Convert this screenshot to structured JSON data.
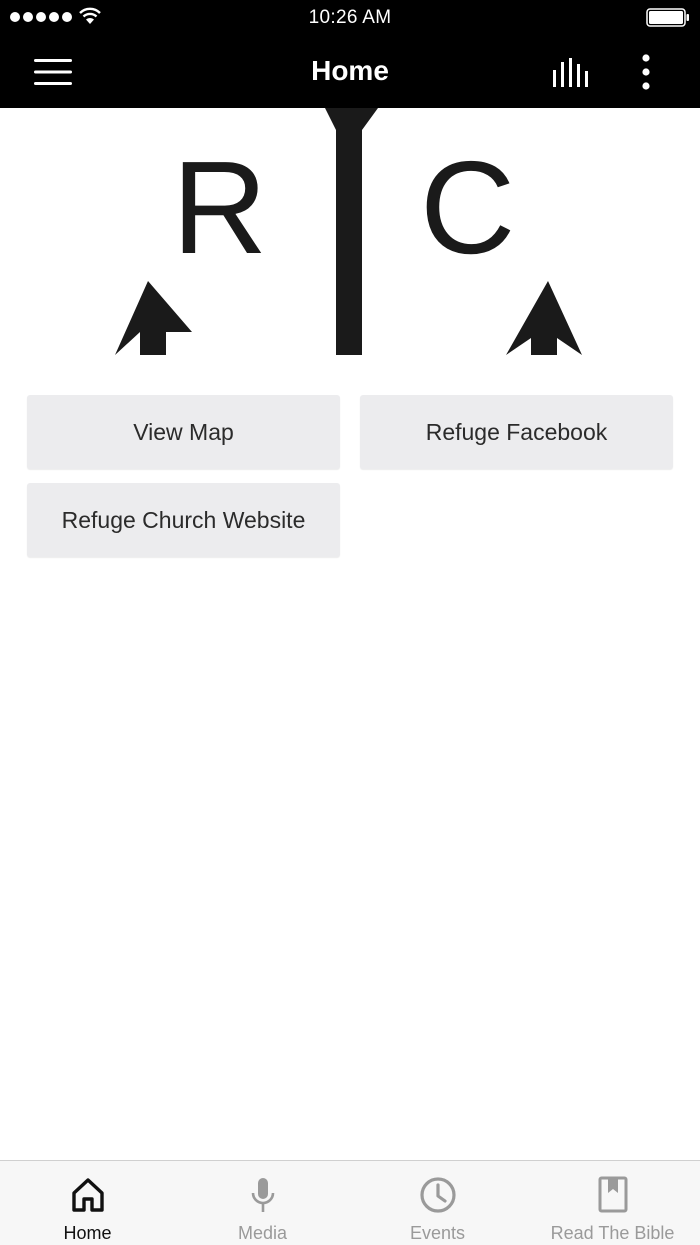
{
  "status_bar": {
    "time": "10:26 AM"
  },
  "nav": {
    "title": "Home",
    "icons": [
      "menu-icon",
      "equalizer-icon",
      "more-vertical-icon"
    ]
  },
  "banner": {
    "logo_letters": [
      "R",
      "C"
    ]
  },
  "buttons": {
    "view_map": "View Map",
    "refuge_facebook": "Refuge Facebook",
    "church_website": "Refuge Church Website"
  },
  "tabs": [
    {
      "label": "Home",
      "icon": "home-icon",
      "active": true
    },
    {
      "label": "Media",
      "icon": "microphone-icon",
      "active": false
    },
    {
      "label": "Events",
      "icon": "clock-icon",
      "active": false
    },
    {
      "label": "Read The Bible",
      "icon": "bookmark-book-icon",
      "active": false
    }
  ],
  "colors": {
    "bar_background": "#000000",
    "button_background": "#ececee",
    "tab_active": "#111111",
    "tab_inactive": "#9a9a9a"
  }
}
